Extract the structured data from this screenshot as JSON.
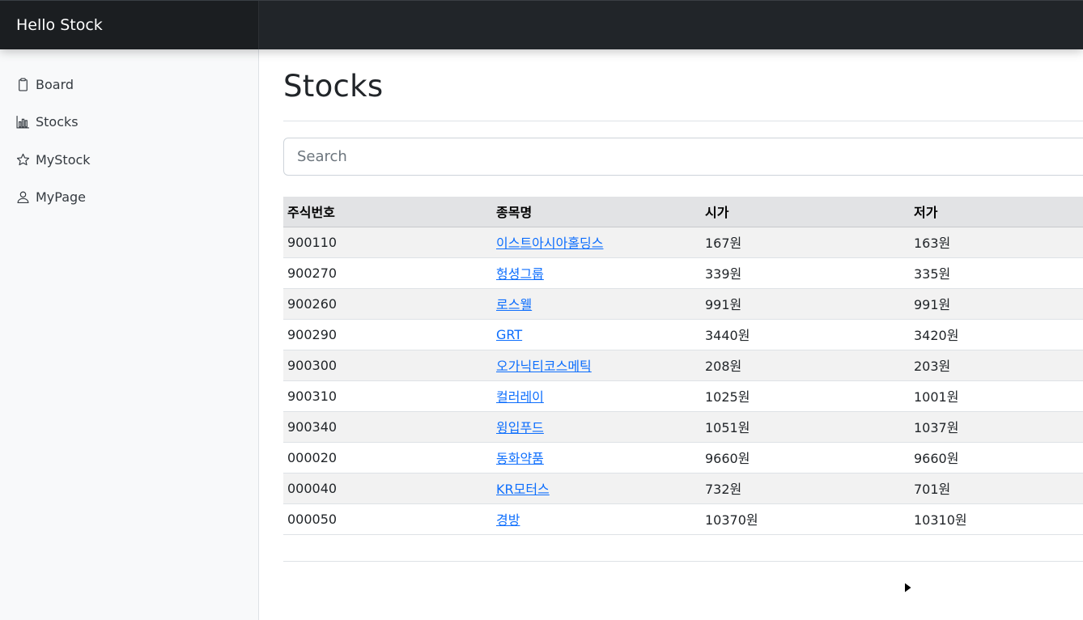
{
  "app": {
    "brand": "Hello Stock"
  },
  "sidebar": {
    "items": [
      {
        "label": "Board",
        "icon": "clipboard-icon"
      },
      {
        "label": "Stocks",
        "icon": "bar-chart-icon"
      },
      {
        "label": "MyStock",
        "icon": "star-icon"
      },
      {
        "label": "MyPage",
        "icon": "person-icon"
      }
    ]
  },
  "main": {
    "title": "Stocks",
    "search": {
      "placeholder": "Search",
      "value": ""
    },
    "table": {
      "headers": [
        "주식번호",
        "종목명",
        "시가",
        "저가"
      ],
      "rows": [
        {
          "code": "900110",
          "name": "이스트아시아홀딩스",
          "open": "167원",
          "low": "163원"
        },
        {
          "code": "900270",
          "name": "헝셩그룹",
          "open": "339원",
          "low": "335원"
        },
        {
          "code": "900260",
          "name": "로스웰",
          "open": "991원",
          "low": "991원"
        },
        {
          "code": "900290",
          "name": "GRT",
          "open": "3440원",
          "low": "3420원"
        },
        {
          "code": "900300",
          "name": "오가닉티코스메틱",
          "open": "208원",
          "low": "203원"
        },
        {
          "code": "900310",
          "name": "컬러레이",
          "open": "1025원",
          "low": "1001원"
        },
        {
          "code": "900340",
          "name": "윙입푸드",
          "open": "1051원",
          "low": "1037원"
        },
        {
          "code": "000020",
          "name": "동화약품",
          "open": "9660원",
          "low": "9660원"
        },
        {
          "code": "000040",
          "name": "KR모터스",
          "open": "732원",
          "low": "701원"
        },
        {
          "code": "000050",
          "name": "경방",
          "open": "10370원",
          "low": "10310원"
        }
      ]
    },
    "pagination": {
      "next_icon": "caret-right-icon"
    }
  },
  "colors": {
    "navbar": "#212529",
    "sidebar": "#f8f9fa",
    "link": "#0d6efd",
    "header_row": "#e2e3e5",
    "striped_row": "#f2f2f2"
  }
}
